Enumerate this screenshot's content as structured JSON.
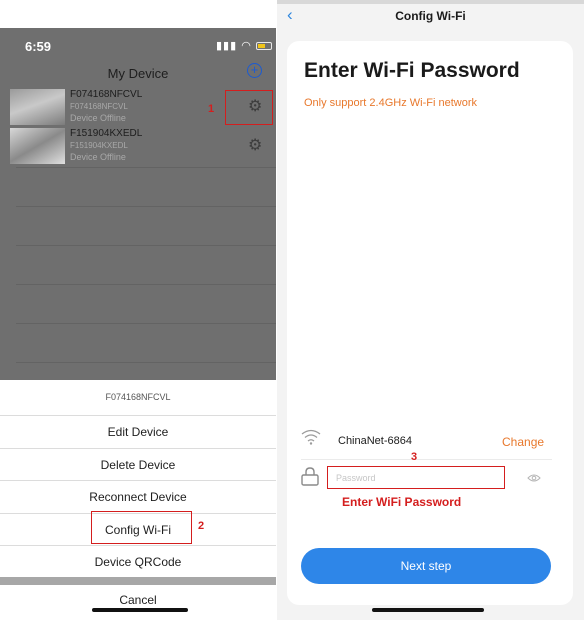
{
  "left_screen": {
    "status_bar": {
      "time": "6:59",
      "icons": [
        "signal-icon",
        "wifi-icon",
        "battery-icon"
      ]
    },
    "nav": {
      "title": "My Device",
      "add_icon": "plus-circle-icon"
    },
    "devices": [
      {
        "name": "F074168NFCVL",
        "id": "F074168NFCVL",
        "status": "Device Offline"
      },
      {
        "name": "F151904KXEDL",
        "id": "F151904KXEDL",
        "status": "Device Offline"
      }
    ],
    "action_sheet": {
      "title": "F074168NFCVL",
      "items": [
        "Edit Device",
        "Delete Device",
        "Reconnect Device",
        "Config Wi-Fi",
        "Device QRCode"
      ],
      "cancel": "Cancel"
    },
    "annotations": {
      "step1": "1",
      "step2": "2"
    }
  },
  "right_screen": {
    "nav": {
      "title": "Config Wi-Fi",
      "back_icon": "chevron-left-icon"
    },
    "heading": "Enter Wi-Fi Password",
    "note": "Only support 2.4GHz Wi-Fi network",
    "network": {
      "ssid": "ChinaNet-6864",
      "change_label": "Change"
    },
    "password": {
      "placeholder": "Password",
      "value": ""
    },
    "annotations": {
      "step3": "3",
      "hint": "Enter WiFi Password"
    },
    "next_button": "Next step"
  },
  "colors": {
    "accent": "#2e86e8",
    "warning": "#e8782c",
    "annotation": "#d41e1e"
  }
}
